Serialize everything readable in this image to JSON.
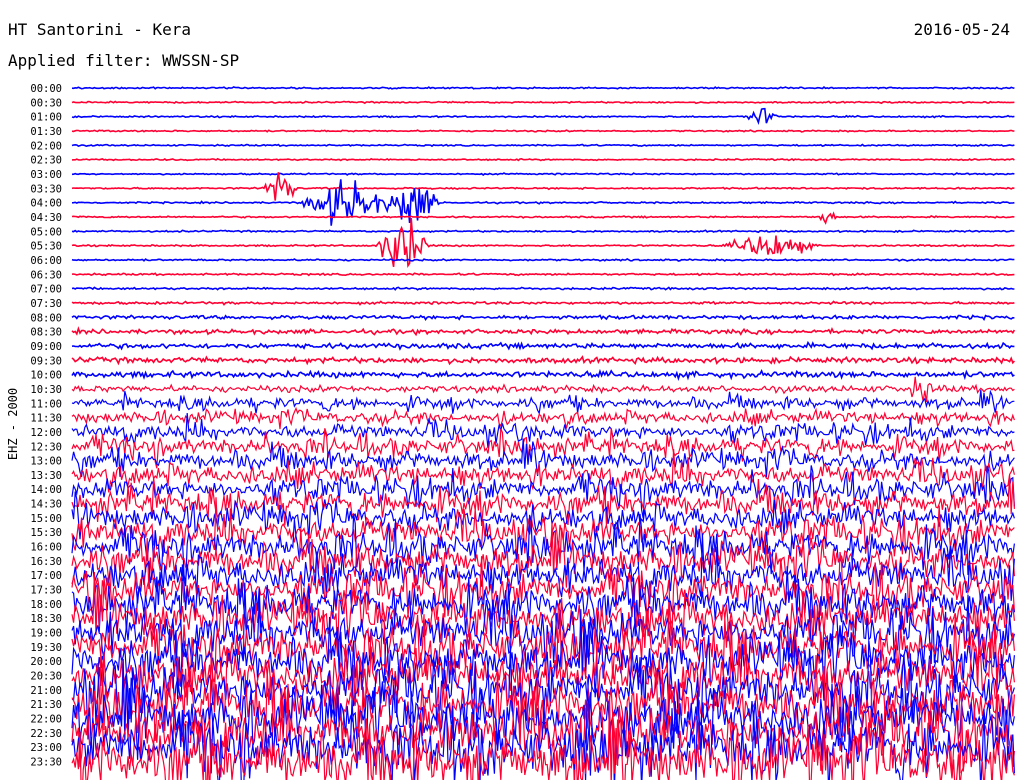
{
  "header": {
    "title": "HT Santorini - Kera",
    "date": "2016-05-24",
    "filter_label": "Applied filter: WWSSN-SP"
  },
  "chart_data": {
    "type": "line",
    "title": "HT Santorini - Kera",
    "subtitle": "Applied filter: WWSSN-SP",
    "ylabel": "EHZ - 2000",
    "xlabel": "",
    "categories": [
      "00:00",
      "00:30",
      "01:00",
      "01:30",
      "02:00",
      "02:30",
      "03:00",
      "03:30",
      "04:00",
      "04:30",
      "05:00",
      "05:30",
      "06:00",
      "06:30",
      "07:00",
      "07:30",
      "08:00",
      "08:30",
      "09:00",
      "09:30",
      "10:00",
      "10:30",
      "11:00",
      "11:30",
      "12:00",
      "12:30",
      "13:00",
      "13:30",
      "14:00",
      "14:30",
      "15:00",
      "15:30",
      "16:00",
      "16:30",
      "17:00",
      "17:30",
      "18:00",
      "18:30",
      "19:00",
      "19:30",
      "20:00",
      "20:30",
      "21:00",
      "21:30",
      "22:00",
      "22:30",
      "23:00",
      "23:30"
    ],
    "colors": [
      "#0000ff",
      "#ff0033"
    ],
    "grid": false,
    "amplitude_levels": [
      0.12,
      0.12,
      0.12,
      0.12,
      0.12,
      0.12,
      0.12,
      0.13,
      0.13,
      0.13,
      0.13,
      0.13,
      0.14,
      0.15,
      0.17,
      0.2,
      0.3,
      0.35,
      0.42,
      0.45,
      0.48,
      0.55,
      0.7,
      0.8,
      0.95,
      1.05,
      1.15,
      1.3,
      1.4,
      1.5,
      1.6,
      1.75,
      1.9,
      2.0,
      2.1,
      2.2,
      2.3,
      2.4,
      2.5,
      2.6,
      2.7,
      2.8,
      2.9,
      3.0,
      3.1,
      3.2,
      3.3,
      3.4
    ],
    "events": [
      {
        "trace": "03:30",
        "position": 0.22,
        "strength": 3.5,
        "duration": 0.02
      },
      {
        "trace": "04:00",
        "position": 0.29,
        "strength": 4.5,
        "duration": 0.05
      },
      {
        "trace": "04:00",
        "position": 0.36,
        "strength": 5.0,
        "duration": 0.03
      },
      {
        "trace": "05:30",
        "position": 0.35,
        "strength": 6.0,
        "duration": 0.03
      },
      {
        "trace": "05:30",
        "position": 0.74,
        "strength": 2.5,
        "duration": 0.05
      },
      {
        "trace": "01:00",
        "position": 0.73,
        "strength": 1.8,
        "duration": 0.02
      },
      {
        "trace": "04:30",
        "position": 0.8,
        "strength": 2.0,
        "duration": 0.01
      },
      {
        "trace": "10:30",
        "position": 0.9,
        "strength": 2.0,
        "duration": 0.02
      }
    ]
  }
}
